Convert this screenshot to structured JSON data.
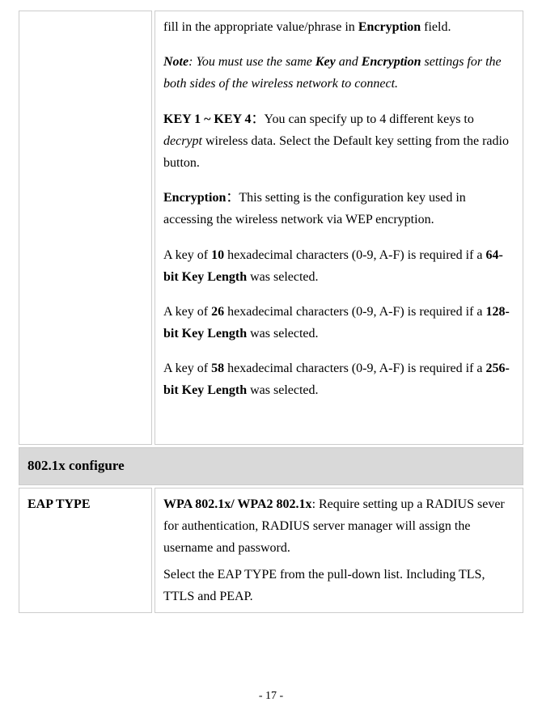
{
  "row1": {
    "p1_pre": "fill in the appropriate value/phrase in ",
    "p1_b": "Encryption",
    "p1_post": " field.",
    "note_label": "Note",
    "note_mid1": ": You must use the same ",
    "note_key": "Key",
    "note_mid2": " and ",
    "note_enc": "Encryption",
    "note_post": " settings for the both sides of the wireless network to connect.",
    "key_label": "KEY 1 ~ KEY 4",
    "colon": "：",
    "key_text1": "You can specify up to 4 different keys to ",
    "key_decrypt": "decrypt",
    "key_text2": " wireless data. Select the Default key setting from the radio button.",
    "enc_label": "Encryption",
    "enc_text": "This setting is the configuration key used in accessing the wireless network via WEP encryption.",
    "k10_pre": "A key of ",
    "k10_n": "10",
    "k10_mid": " hexadecimal characters (0-9, A-F) is required if a ",
    "k10_len": "64-bit Key Length",
    "k10_post": " was selected.",
    "k26_n": "26",
    "k26_len": "128-bit Key Length",
    "k58_n": "58",
    "k58_len": "256-bit Key Length"
  },
  "section_header": "802.1x configure",
  "row2": {
    "left": "EAP TYPE",
    "wpa_label": "WPA 802.1x/ WPA2 802.1x",
    "wpa_text": ": Require setting up a RADIUS sever for authentication, RADIUS server manager will assign the username and password.",
    "eap_text": "Select the EAP TYPE from the pull-down list. Including TLS, TTLS and PEAP."
  },
  "page_number": "- 17 -"
}
